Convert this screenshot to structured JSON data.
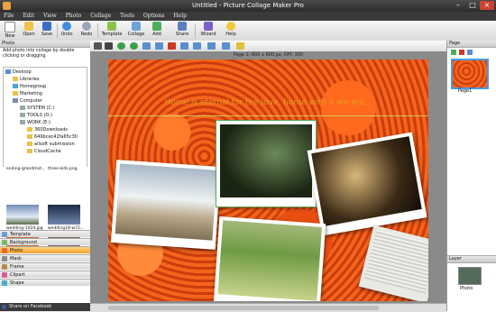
{
  "window": {
    "title": "Untitled - Picture Collage Maker Pro"
  },
  "menu": [
    "File",
    "Edit",
    "View",
    "Photo",
    "Collage",
    "Tools",
    "Options",
    "Help"
  ],
  "toolbar": {
    "new": "New",
    "open": "Open",
    "save": "Save",
    "undo": "Undo",
    "redo": "Redo",
    "template": "Template",
    "collage": "Collage",
    "add": "Add",
    "share": "Share",
    "wizard": "Wizard",
    "help": "Help"
  },
  "left_panel": {
    "header": "Photo",
    "instruction": "Add photo into collage by double clicking or dragging",
    "tree": [
      "Desktop",
      "Libraries",
      "Homegroup",
      "Marketing",
      "Computer",
      "SYSTEM (C:)",
      "TOOLS (D:)",
      "WORK (E:)",
      "360Downloads",
      "649bcec42fa65c30",
      "allsoft submission",
      "CloudCache"
    ],
    "thumbs": [
      "ending-grandmot...",
      "three-kids.png",
      "wedding-1024.jpg",
      "wedding18-w72..."
    ],
    "categories": [
      "Template",
      "Background",
      "Photo",
      "Mask",
      "Frame",
      "Clipart",
      "Shape"
    ],
    "active_category": "Photo"
  },
  "canvas": {
    "page_info": "Page 1: 800 x 600 px, DPI: 300",
    "overlay_text": "Home is eternal for the love, home with it we are..."
  },
  "right_panel": {
    "pages_header": "Page",
    "page_label": "Page1",
    "layer_header": "Layer",
    "layer_item": "Photo"
  },
  "status": {
    "share": "Share on Facebook"
  },
  "colors": {
    "accent": "#f2a232",
    "titlebar": "#2c2c2c",
    "selection": "#4a9be8"
  }
}
